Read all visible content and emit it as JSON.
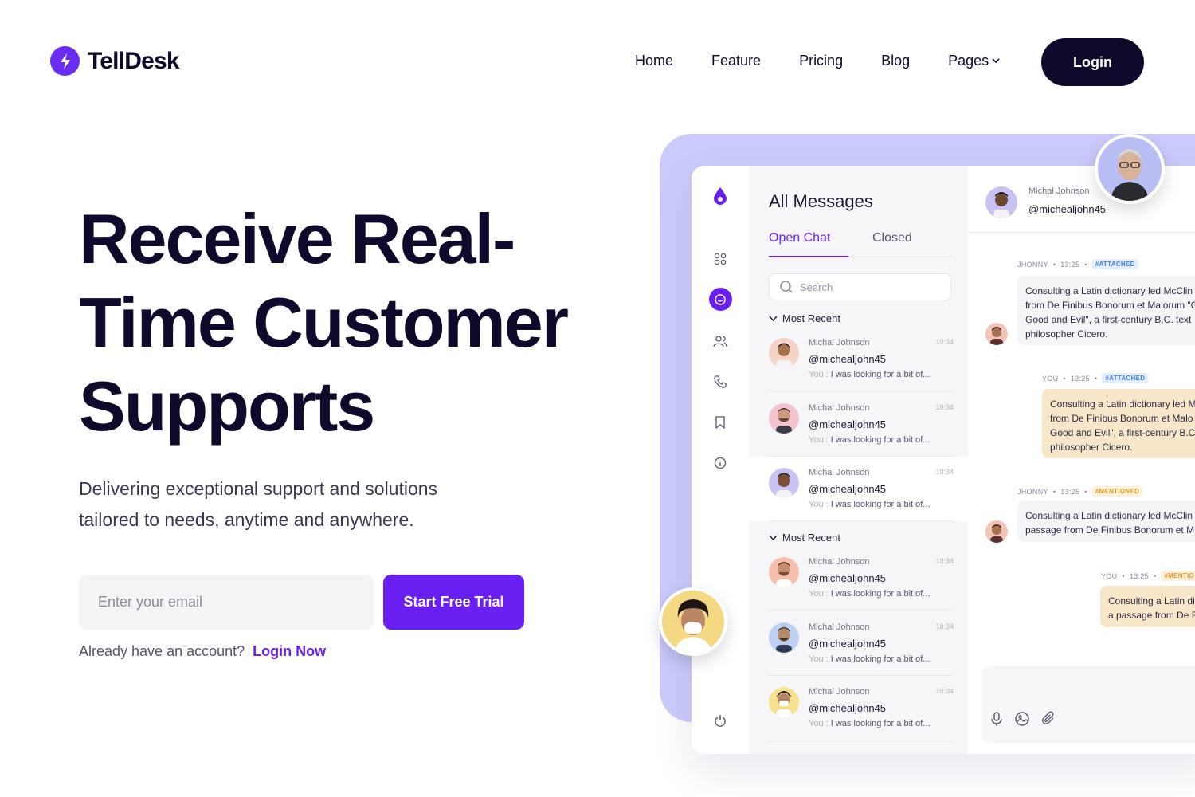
{
  "brand": {
    "name": "TellDesk",
    "accent": "#6a1ff1",
    "dark": "#0d0a2c"
  },
  "nav": {
    "items": [
      "Home",
      "Feature",
      "Pricing",
      "Blog",
      "Pages"
    ],
    "login_label": "Login"
  },
  "hero": {
    "title_line1": "Receive Real-",
    "title_line2": "Time Customer",
    "title_line3": "Supports",
    "subtitle": "Delivering exceptional support and solutions tailored to needs, anytime and anywhere.",
    "email_placeholder": "Enter your email",
    "cta_label": "Start Free Trial",
    "account_text": "Already have an account?",
    "login_now_label": "Login Now"
  },
  "app": {
    "title": "All Messages",
    "tabs": [
      "Open Chat",
      "Closed"
    ],
    "search_placeholder": "Search",
    "section_label": "Most Recent",
    "chats": [
      {
        "name": "Michal Johnson",
        "handle": "@michealjohn45",
        "you": "You :",
        "preview": " I was looking for a bit of...",
        "time": "10:34"
      },
      {
        "name": "Michal Johnson",
        "handle": "@michealjohn45",
        "you": "You :",
        "preview": " I was looking for a bit of...",
        "time": "10:34"
      },
      {
        "name": "Michal Johnson",
        "handle": "@michealjohn45",
        "you": "You :",
        "preview": " I was looking for a bit of...",
        "time": "10:34"
      },
      {
        "name": "Michal Johnson",
        "handle": "@michealjohn45",
        "you": "You :",
        "preview": " I was looking for a bit of...",
        "time": "10:34"
      },
      {
        "name": "Michal Johnson",
        "handle": "@michealjohn45",
        "you": "You :",
        "preview": " I was looking for a bit of...",
        "time": "10:34"
      },
      {
        "name": "Michal Johnson",
        "handle": "@michealjohn45",
        "you": "You :",
        "preview": " I was looking for a bit of...",
        "time": "10:34"
      }
    ],
    "conversation": {
      "name": "Michal Johnson",
      "handle": "@michealjohn45",
      "messages": [
        {
          "sender": "JHONNY",
          "time": "13:25",
          "tag": "#ATTACHED",
          "lines": [
            "Consulting a Latin dictionary led McClin",
            "from De Finibus Bonorum et Malorum \"G",
            "Good and Evil\", a first-century B.C. text",
            "philosopher Cicero."
          ]
        },
        {
          "sender": "YOU",
          "time": "13:25",
          "tag": "#ATTACHED",
          "lines": [
            "Consulting a Latin dictionary led M",
            "from De Finibus Bonorum et Malo",
            "Good and Evil\", a first-century B.C",
            "philosopher Cicero."
          ]
        },
        {
          "sender": "JHONNY",
          "time": "13:25",
          "tag": "#MENTIONED",
          "lines": [
            "Consulting a Latin dictionary led McClin",
            "passage from De Finibus Bonorum et M"
          ]
        },
        {
          "sender": "YOU",
          "time": "13:25",
          "tag": "#MENTIO",
          "lines": [
            "Consulting a Latin di",
            "a passage from De F"
          ]
        }
      ]
    }
  }
}
